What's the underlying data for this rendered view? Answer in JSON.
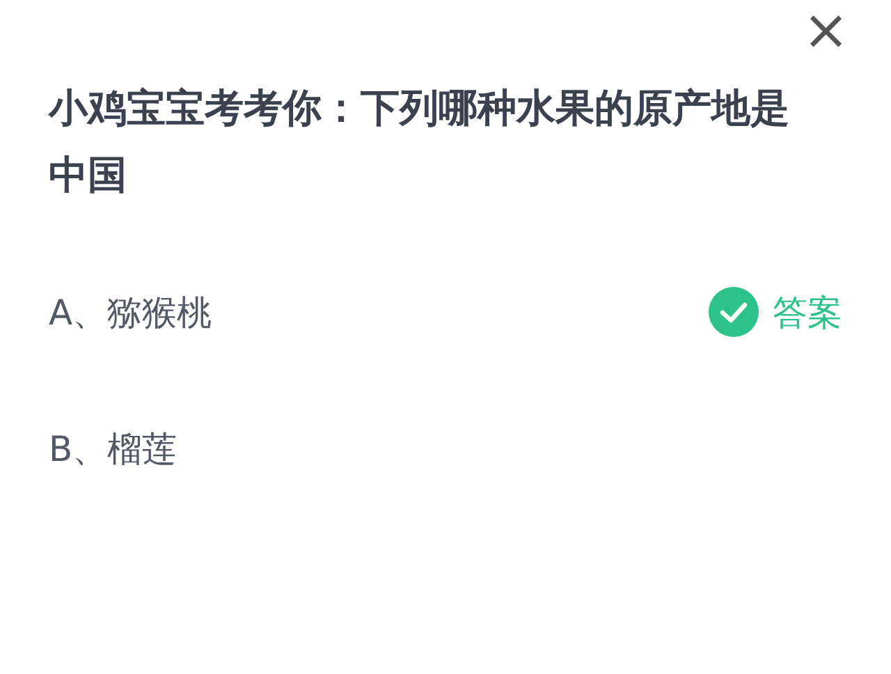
{
  "close": "×",
  "question": "小鸡宝宝考考你：下列哪种水果的原产地是中国",
  "answer_label": "答案",
  "options": [
    {
      "label": "A、猕猴桃",
      "correct": true
    },
    {
      "label": "B、榴莲",
      "correct": false
    }
  ]
}
